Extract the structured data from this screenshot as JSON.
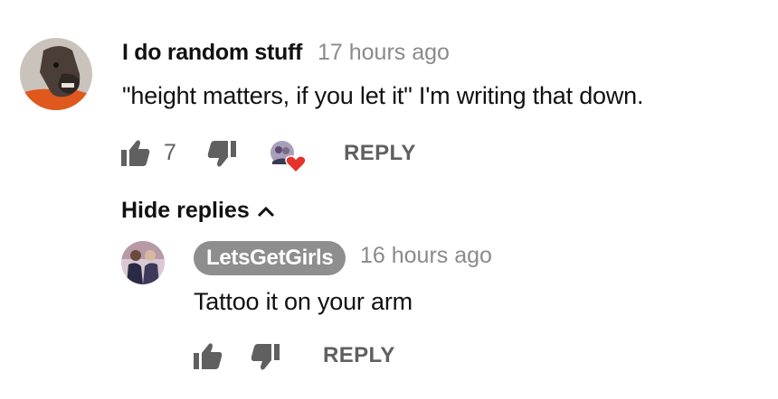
{
  "comment": {
    "author": "I do random stuff",
    "time": "17 hours ago",
    "text": "\"height matters, if you let it\" I'm writing that down.",
    "likes": "7",
    "reply_label": "REPLY",
    "avatar_icon": "horse-mask-avatar",
    "creator_heart_icon": "creator-heart-icon"
  },
  "replies_toggle": {
    "label": "Hide replies",
    "icon": "chevron-up-icon"
  },
  "reply": {
    "author": "LetsGetGirls",
    "time": "16 hours ago",
    "text": "Tattoo it on your arm",
    "reply_label": "REPLY",
    "avatar_icon": "channel-avatar"
  },
  "colors": {
    "secondary_text": "#8a8a8a",
    "icon_gray": "#606060",
    "badge_bg": "#8e8e8e",
    "heart": "#e5322d"
  }
}
